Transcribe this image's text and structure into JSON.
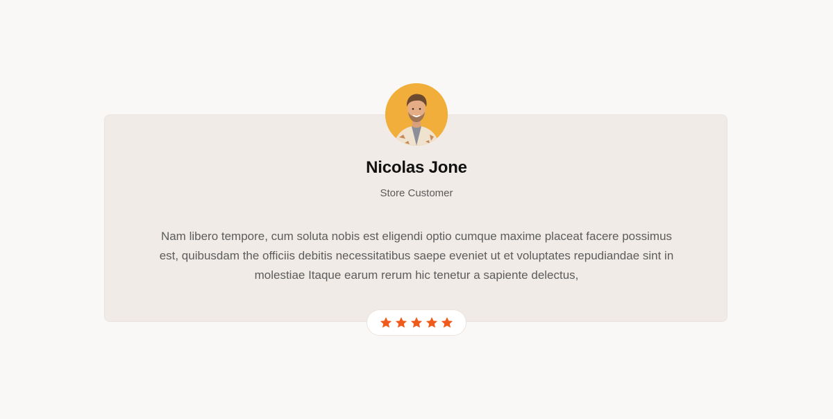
{
  "testimonial": {
    "name": "Nicolas Jone",
    "role": "Store Customer",
    "quote": "Nam libero tempore, cum soluta nobis est eligendi optio cumque maxime placeat facere possimus est, quibusdam the officiis debitis necessitatibus saepe eveniet ut et voluptates repudiandae sint in molestiae Itaque earum rerum hic tenetur a sapiente delectus,",
    "rating": 5,
    "rating_max": 5,
    "avatar_icon": "customer-portrait"
  },
  "colors": {
    "page_bg": "#faf8f6",
    "card_bg": "#f0ebe7",
    "star": "#f05a1a",
    "avatar_bg": "#f1ae3a"
  }
}
